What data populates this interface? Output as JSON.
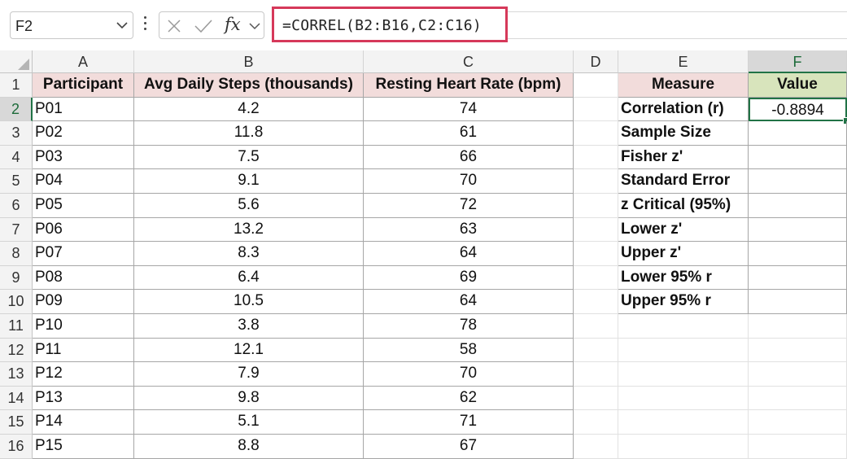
{
  "name_box": {
    "value": "F2"
  },
  "formula_bar": {
    "fx_label": "fx",
    "formula": "=CORREL(B2:B16,C2:C16)"
  },
  "columns": [
    "A",
    "B",
    "C",
    "D",
    "E",
    "F"
  ],
  "rows": [
    "1",
    "2",
    "3",
    "4",
    "5",
    "6",
    "7",
    "8",
    "9",
    "10",
    "11",
    "12",
    "13",
    "14",
    "15",
    "16"
  ],
  "table": {
    "headers": [
      "Participant",
      "Avg Daily Steps (thousands)",
      "Resting Heart Rate (bpm)"
    ],
    "rows": [
      [
        "P01",
        "4.2",
        "74"
      ],
      [
        "P02",
        "11.8",
        "61"
      ],
      [
        "P03",
        "7.5",
        "66"
      ],
      [
        "P04",
        "9.1",
        "70"
      ],
      [
        "P05",
        "5.6",
        "72"
      ],
      [
        "P06",
        "13.2",
        "63"
      ],
      [
        "P07",
        "8.3",
        "64"
      ],
      [
        "P08",
        "6.4",
        "69"
      ],
      [
        "P09",
        "10.5",
        "64"
      ],
      [
        "P10",
        "3.8",
        "78"
      ],
      [
        "P11",
        "12.1",
        "58"
      ],
      [
        "P12",
        "7.9",
        "70"
      ],
      [
        "P13",
        "9.8",
        "62"
      ],
      [
        "P14",
        "5.1",
        "71"
      ],
      [
        "P15",
        "8.8",
        "67"
      ]
    ]
  },
  "stats": {
    "headers": [
      "Measure",
      "Value"
    ],
    "rows": [
      [
        "Correlation (r)",
        "-0.8894"
      ],
      [
        "Sample Size",
        ""
      ],
      [
        "Fisher z'",
        ""
      ],
      [
        "Standard Error",
        ""
      ],
      [
        "z Critical (95%)",
        ""
      ],
      [
        "Lower z'",
        ""
      ],
      [
        "Upper z'",
        ""
      ],
      [
        "Lower 95% r",
        ""
      ],
      [
        "Upper 95% r",
        ""
      ]
    ]
  },
  "colors": {
    "selection": "#217346",
    "formula_highlight": "#d6395a",
    "header_pink": "#f2dcdb",
    "header_green": "#d8e4bc"
  },
  "icons": {
    "name_box_dropdown": "chevron-down-icon",
    "more": "vertical-ellipsis-icon",
    "cancel": "close-icon",
    "enter": "checkmark-icon",
    "insert_function": "fx-icon",
    "fx_dropdown": "chevron-down-icon"
  }
}
